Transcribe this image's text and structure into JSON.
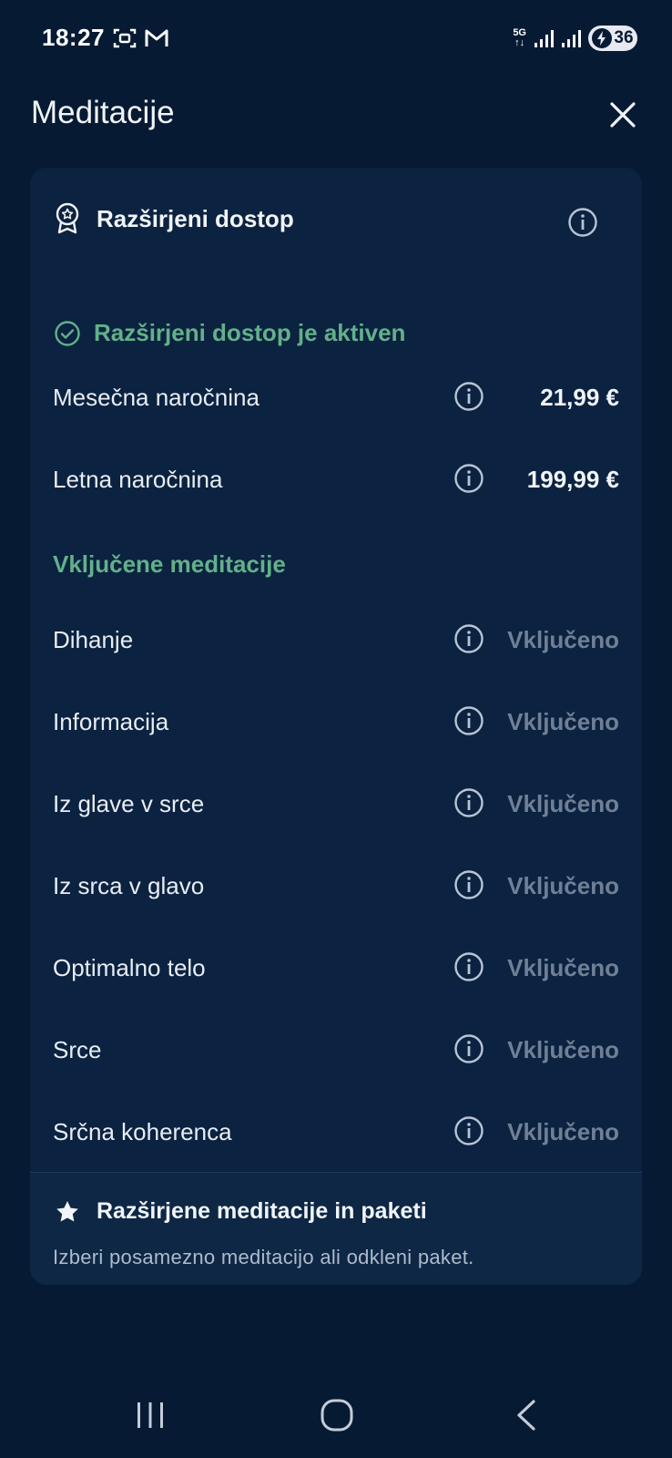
{
  "status_bar": {
    "time": "18:27",
    "network_top": "5G",
    "network_bottom": "↑↓",
    "battery": "36"
  },
  "header": {
    "title": "Meditacije"
  },
  "card": {
    "title": "Razširjeni dostop",
    "active_text": "Razširjeni dostop je aktiven",
    "subscriptions": [
      {
        "label": "Mesečna naročnina",
        "value": "21,99 €"
      },
      {
        "label": "Letna naročnina",
        "value": "199,99 €"
      }
    ],
    "section_title": "Vključene meditacije",
    "meditations": [
      {
        "label": "Dihanje",
        "value": "Vključeno"
      },
      {
        "label": "Informacija",
        "value": "Vključeno"
      },
      {
        "label": "Iz glave v srce",
        "value": "Vključeno"
      },
      {
        "label": "Iz srca v glavo",
        "value": "Vključeno"
      },
      {
        "label": "Optimalno telo",
        "value": "Vključeno"
      },
      {
        "label": "Srce",
        "value": "Vključeno"
      },
      {
        "label": "Srčna koherenca",
        "value": "Vključeno"
      }
    ],
    "footer": {
      "title": "Razširjene meditacije in paketi",
      "subtitle": "Izberi posamezno meditacijo ali odkleni paket."
    }
  },
  "colors": {
    "background": "#071a33",
    "card": "#0b2240",
    "accent_green": "#63b08a",
    "muted": "#6f8096"
  }
}
